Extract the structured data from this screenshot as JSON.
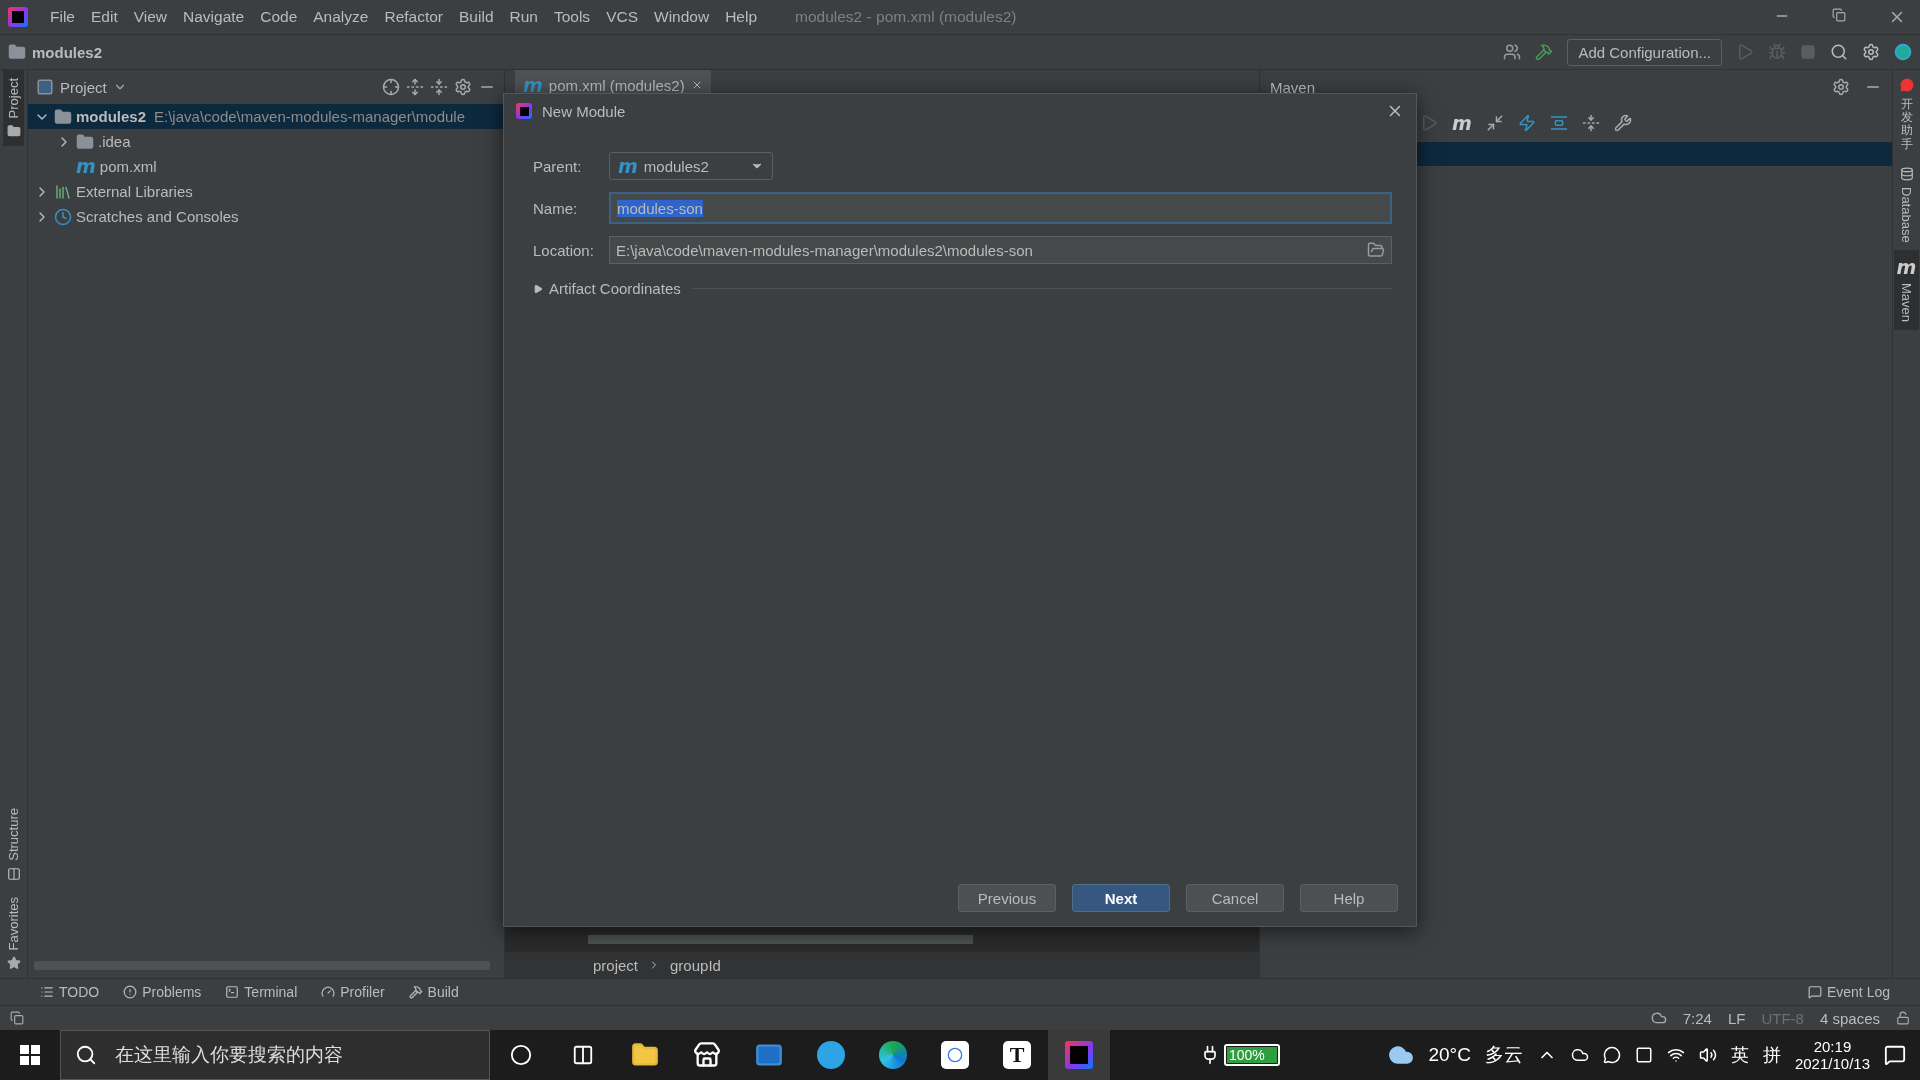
{
  "window": {
    "title": "modules2 - pom.xml (modules2)"
  },
  "menu": [
    "File",
    "Edit",
    "View",
    "Navigate",
    "Code",
    "Analyze",
    "Refactor",
    "Build",
    "Run",
    "Tools",
    "VCS",
    "Window",
    "Help"
  ],
  "navbar": {
    "breadcrumb": "modules2",
    "run_config": "Add Configuration..."
  },
  "left_stripe": [
    {
      "label": "Project",
      "selected": true
    },
    {
      "label": "Structure",
      "selected": false
    },
    {
      "label": "Favorites",
      "selected": false
    }
  ],
  "project_panel": {
    "title": "Project",
    "tree": [
      {
        "label": "modules2",
        "path": "E:\\java\\code\\maven-modules-manager\\module",
        "kind": "module",
        "expanded": true,
        "selected": true,
        "children": [
          {
            "label": ".idea",
            "kind": "folder",
            "expanded": false,
            "selected": false
          },
          {
            "label": "pom.xml",
            "kind": "maven",
            "glyph": "m",
            "selected": false
          }
        ]
      },
      {
        "label": "External Libraries",
        "kind": "library",
        "expanded": false,
        "selected": false
      },
      {
        "label": "Scratches and Consoles",
        "kind": "scratch",
        "expanded": false,
        "selected": false
      }
    ]
  },
  "editor": {
    "tabs": [
      {
        "label": "pom.xml (modules2)",
        "glyph": "m",
        "selected": true
      }
    ],
    "breadcrumbs": [
      "project",
      "groupId"
    ]
  },
  "maven_panel": {
    "title": "Maven",
    "toolbar_glyph": "m"
  },
  "right_stripe": [
    {
      "label": "开发助手",
      "cjk": true,
      "selected": false
    },
    {
      "label": "Database",
      "cjk": false,
      "selected": false
    },
    {
      "label": "Maven",
      "glyph": "m",
      "cjk": false,
      "selected": true
    }
  ],
  "dialog": {
    "title": "New Module",
    "fields": [
      {
        "label": "Parent:",
        "kind": "select",
        "glyph": "m",
        "value": "modules2"
      },
      {
        "label": "Name:",
        "kind": "text",
        "value": "modules-son",
        "focused": true
      },
      {
        "label": "Location:",
        "kind": "path",
        "value": "E:\\java\\code\\maven-modules-manager\\modules2\\modules-son",
        "focused": false
      }
    ],
    "section": {
      "label": "Artifact Coordinates",
      "expanded": false
    },
    "buttons": [
      {
        "label": "Previous",
        "primary": false
      },
      {
        "label": "Next",
        "primary": true
      },
      {
        "label": "Cancel",
        "primary": false
      },
      {
        "label": "Help",
        "primary": false
      }
    ]
  },
  "tool_windows": [
    {
      "label": "TODO",
      "kind": "todo"
    },
    {
      "label": "Problems",
      "kind": "problems"
    },
    {
      "label": "Terminal",
      "kind": "terminal"
    },
    {
      "label": "Profiler",
      "kind": "profiler"
    },
    {
      "label": "Build",
      "kind": "build"
    }
  ],
  "event_log": "Event Log",
  "status_bar": [
    {
      "label": "7:24",
      "disabled": false
    },
    {
      "label": "LF",
      "disabled": false
    },
    {
      "label": "UTF-8",
      "disabled": true
    },
    {
      "label": "4 spaces",
      "disabled": false
    }
  ],
  "taskbar": {
    "search_placeholder": "在这里输入你要搜索的内容",
    "app_letter": "T",
    "battery": "100%",
    "weather": "20°C",
    "weather_desc": "多云",
    "ime": "英",
    "ime2": "拼",
    "time": "20:19",
    "date": "2021/10/13"
  }
}
